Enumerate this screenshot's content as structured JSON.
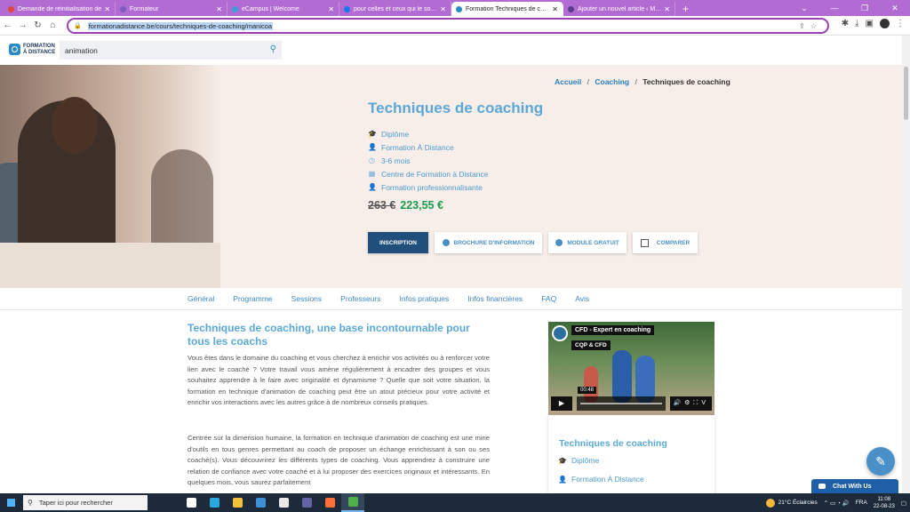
{
  "browser": {
    "tabs": [
      {
        "title": "Demande de réinitialisation de",
        "color": "#e0453a",
        "active": false
      },
      {
        "title": "Formateur",
        "color": "#7a5cc0",
        "active": false
      },
      {
        "title": "eCampus | Welcome",
        "color": "#3ca0d8",
        "active": false
      },
      {
        "title": "pour celles et ceux qui le souhait",
        "color": "#1877f2",
        "active": false
      },
      {
        "title": "Formation Techniques de coach",
        "color": "#2a8bc1",
        "active": true
      },
      {
        "title": "Ajouter un nouvel article ‹ Melle",
        "color": "#5b3a8c",
        "active": false
      }
    ],
    "new_tab": "+",
    "url": "formationadistance.be/cours/techniques-de-coaching/manicoa",
    "accent": "#b36bd4"
  },
  "site": {
    "logo_line1": "FORMATION",
    "logo_line2": "À DISTANCE",
    "search_value": "animation"
  },
  "breadcrumb": {
    "home": "Accueil",
    "sep1": "/",
    "category": "Coaching",
    "sep2": "/",
    "current": "Techniques de coaching"
  },
  "course": {
    "title": "Techniques de coaching",
    "meta": [
      {
        "icon": "graduation-cap-icon",
        "glyph": "🎓",
        "text": "Diplôme"
      },
      {
        "icon": "user-icon",
        "glyph": "👤",
        "text": "Formation À Distance"
      },
      {
        "icon": "clock-icon",
        "glyph": "◷",
        "text": "3-6 mois"
      },
      {
        "icon": "building-icon",
        "glyph": "▦",
        "text": "Centre de Formation à Distance"
      },
      {
        "icon": "person-icon",
        "glyph": "👤",
        "text": "Formation professionnalisante"
      }
    ],
    "old_price": "263 €",
    "new_price": "223,55 €",
    "buttons": {
      "inscription": "INSCRIPTION",
      "brochure": "BROCHURE D'INFORMATION",
      "module": "MODULE GRATUIT",
      "compare": "COMPARER"
    }
  },
  "subnav": [
    "Général",
    "Programme",
    "Sessions",
    "Professeurs",
    "Infos pratiques",
    "Infos financières",
    "FAQ",
    "Avis"
  ],
  "article": {
    "title": "Techniques de coaching, une base incontournable pour tous les coachs",
    "para1": "Vous êtes dans le domaine du coaching et vous cherchez à enrichir vos activités ou à renforcer votre lien avec le coaché ? Votre travail vous amène régulièrement à encadrer des groupes et vous souhaitez apprendre à le faire avec originalité et dynamisme ? Quelle que soit votre situation, la formation en technique d'animation de coaching peut être un atout précieux pour votre activité et enrichir vos interactions avec les autres grâce à de nombreux conseils pratiques.",
    "para2": "Centrée sur la dimension humaine, la formation en technique d'animation de coaching est une mine d'outils en tous genres permettant au coach de proposer un échange enrichissant à son ou ses coaché(s). Vous découvrirez les différents types de coaching. Vous apprendrez à construire une relation de confiance avec votre coaché et à lui proposer des exercices originaux et intéressants. En quelques mois, vous saurez parfaitement"
  },
  "video": {
    "title": "CFD - Expert en coaching",
    "subtitle": "CQP & CFD",
    "time": "00:48"
  },
  "card": {
    "title": "Techniques de coaching",
    "rows": [
      {
        "icon": "graduation-cap-icon",
        "glyph": "🎓",
        "text": "Diplôme"
      },
      {
        "icon": "user-icon",
        "glyph": "👤",
        "text": "Formation À Distance"
      }
    ]
  },
  "chat": {
    "label": "Chat With Us"
  },
  "taskbar": {
    "search_placeholder": "Taper ici pour rechercher",
    "weather": "21°C  Éclaircies",
    "lang": "FRA",
    "time": "11:08",
    "date": "22-08-23",
    "apps": [
      {
        "name": "task-view-icon",
        "color": "#ffffff"
      },
      {
        "name": "edge-icon",
        "color": "#2ba7e0"
      },
      {
        "name": "file-explorer-icon",
        "color": "#f3c13a"
      },
      {
        "name": "mail-icon",
        "color": "#3d8fd8"
      },
      {
        "name": "store-icon",
        "color": "#e8e8e8"
      },
      {
        "name": "teams-icon",
        "color": "#6264a7"
      },
      {
        "name": "firefox-icon",
        "color": "#ff7139"
      },
      {
        "name": "chrome-icon",
        "color": "#4fb04a"
      }
    ]
  }
}
